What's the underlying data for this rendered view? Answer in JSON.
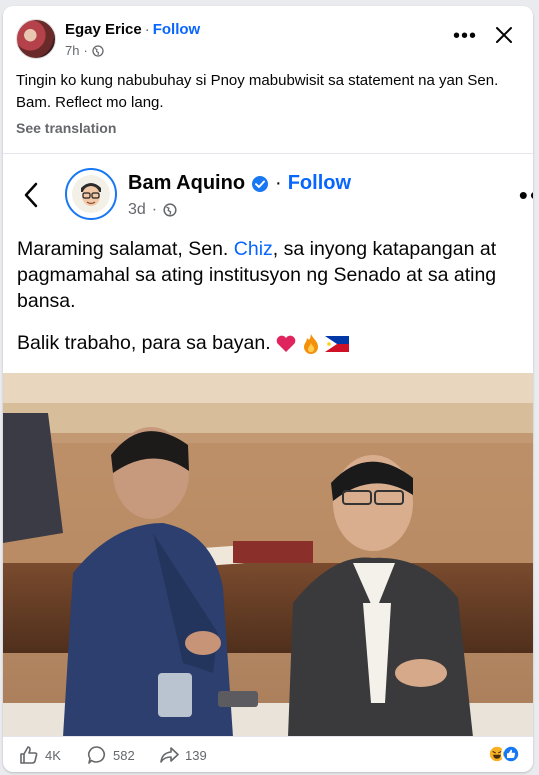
{
  "header": {
    "name": "Egay Erice",
    "follow": "Follow",
    "time": "7h",
    "separator": "·"
  },
  "post": {
    "text": "Tingin ko kung nabubuhay si Pnoy mabubwisit  sa statement na yan Sen. Bam. Reflect mo lang.",
    "see_translation": "See translation"
  },
  "embedded": {
    "name": "Bam Aquino",
    "follow": "Follow",
    "time": "3d",
    "line1_pre": "Maraming salamat, Sen. ",
    "line1_link": "Chiz",
    "line1_post": ", sa inyong katapangan at",
    "line2": "pagmamahal sa ating institusyon ng Senado at sa ating",
    "line3": "bansa.",
    "line4": "Balik trabaho, para sa bayan.",
    "emojis": [
      "heart",
      "fire",
      "philippine-flag"
    ]
  },
  "actions": {
    "likes": "4K",
    "comments": "582",
    "shares": "139"
  },
  "colors": {
    "accent": "#0866ff",
    "muted": "#65676b"
  }
}
